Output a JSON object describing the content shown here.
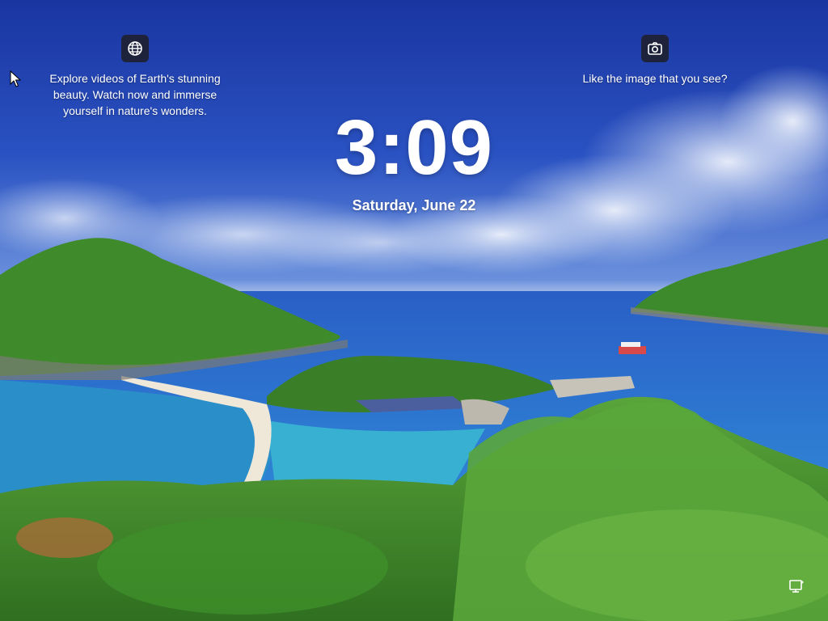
{
  "lock_screen": {
    "time": "3:09",
    "date": "Saturday, June 22"
  },
  "widgets": {
    "left": {
      "icon": "globe-icon",
      "text": "Explore videos of Earth's stunning beauty. Watch now and immerse yourself in nature's wonders."
    },
    "right": {
      "icon": "camera-icon",
      "text": "Like the image that you see?"
    }
  },
  "status": {
    "icon": "network-icon"
  },
  "colors": {
    "sky_top": "#1b3aa6",
    "sky_mid": "#5b86d8",
    "sea": "#2a7fd0",
    "lagoon": "#35b3d6",
    "forest": "#3f8a2a",
    "icon_bg": "#1e1e28"
  }
}
